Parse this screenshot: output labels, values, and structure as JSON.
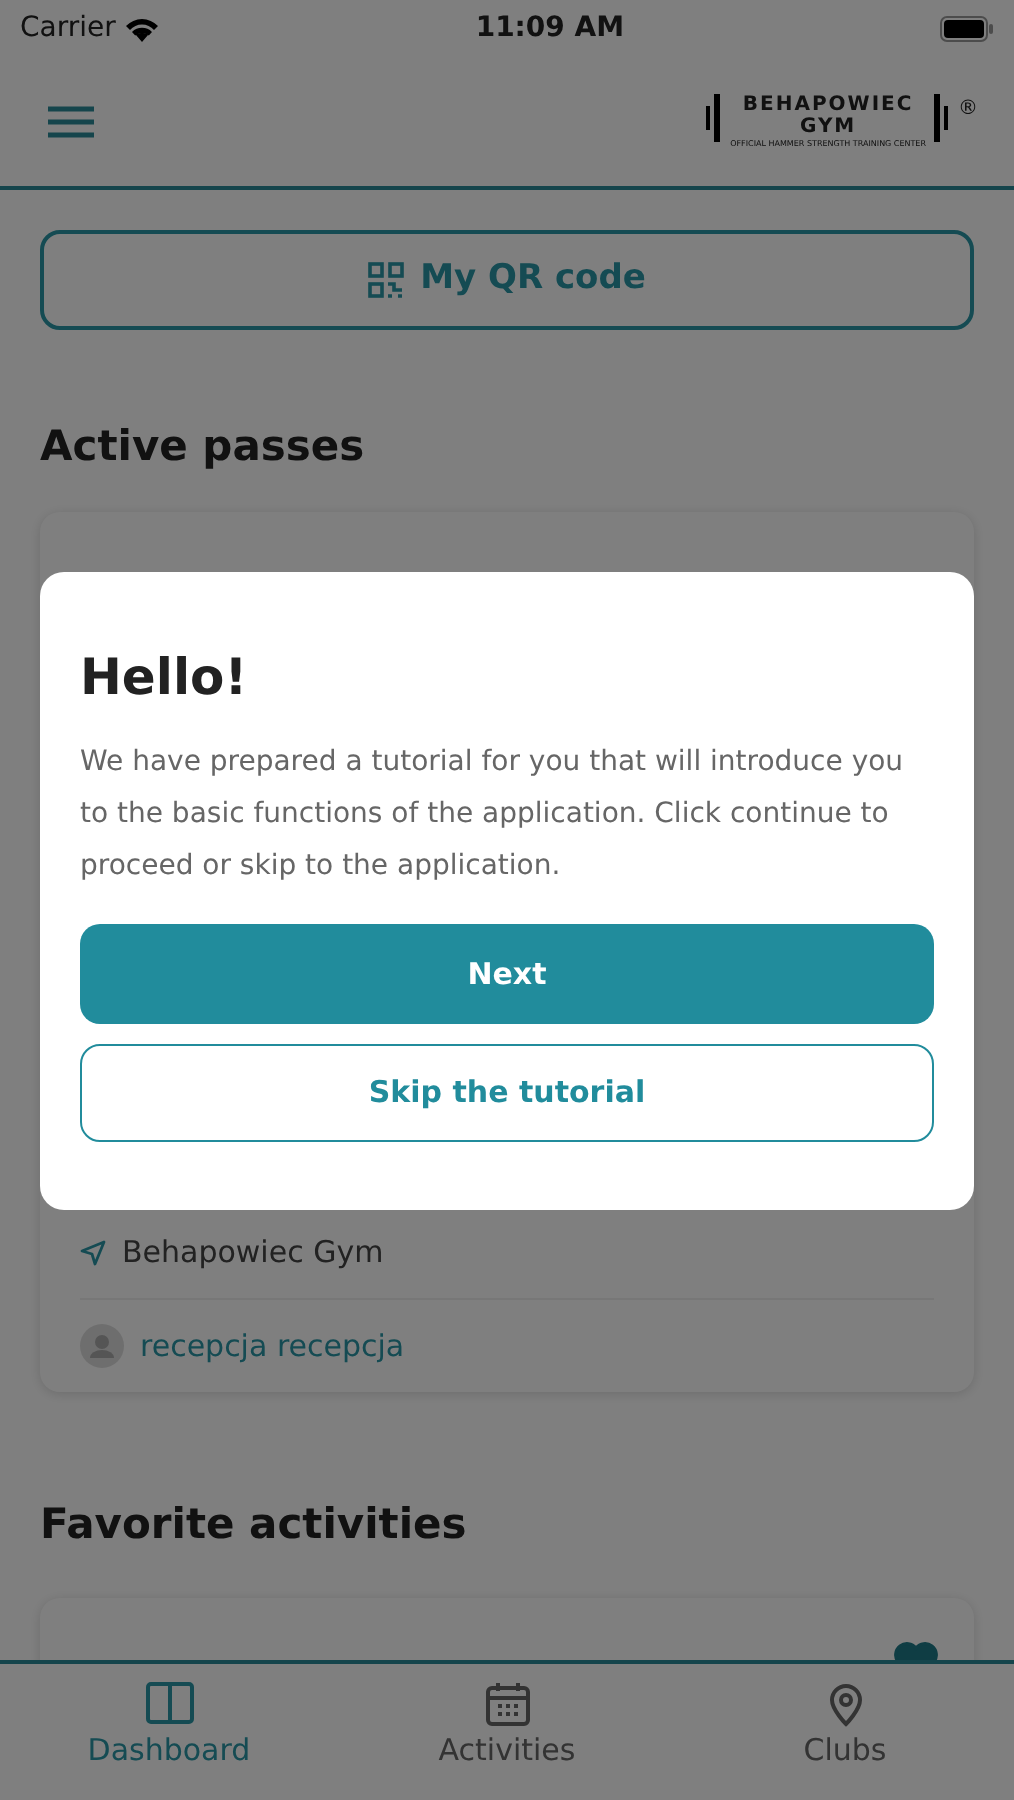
{
  "status_bar": {
    "carrier": "Carrier",
    "time": "11:09 AM"
  },
  "header": {
    "logo_name": "BEHAPOWIEC",
    "logo_sub": "GYM",
    "logo_tagline": "OFFICIAL HAMMER STRENGTH TRAINING CENTER",
    "logo_mark": "®"
  },
  "qr_button": {
    "label": "My QR code"
  },
  "active_passes": {
    "title": "Active passes",
    "pass": {
      "club": "Behapowiec Gym",
      "trainer": "recepcja recepcja"
    }
  },
  "favorite_activities": {
    "title": "Favorite activities",
    "items": [
      {
        "favorite": true
      }
    ]
  },
  "tab_bar": [
    {
      "label": "Dashboard",
      "kind": "dashboard",
      "selected": true
    },
    {
      "label": "Activities",
      "kind": "calendar",
      "selected": false
    },
    {
      "label": "Clubs",
      "kind": "pin",
      "selected": false
    }
  ],
  "dialog": {
    "title": "Hello!",
    "message": "We have prepared a tutorial for you that will introduce you to the basic functions of the application. Click continue to proceed or skip to the application.",
    "primary_button": "Next",
    "secondary_button": "Skip the tutorial"
  }
}
